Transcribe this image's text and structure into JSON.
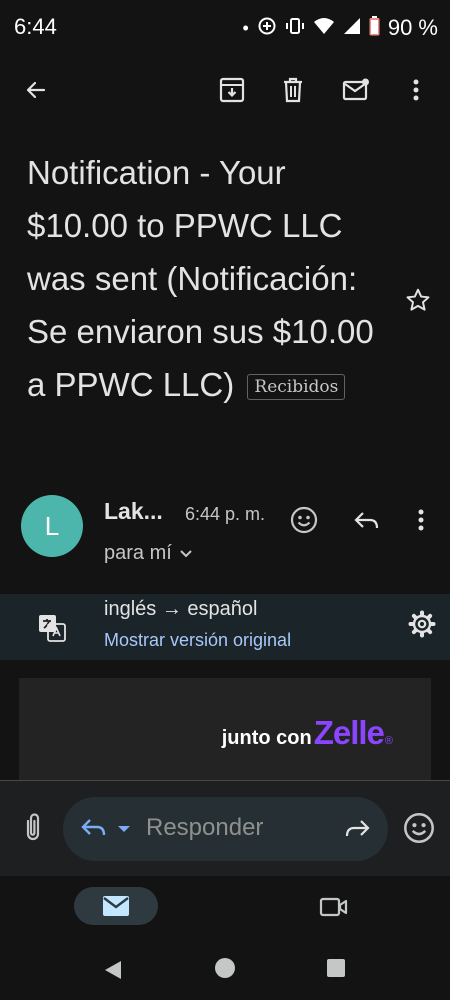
{
  "status_bar": {
    "time": "6:44",
    "battery": "90 %"
  },
  "email": {
    "subject": "Notification - Your $10.00 to PPWC LLC was sent (Notificación: Se enviaron sus $10.00 a PPWC LLC)",
    "label": "Recibidos",
    "sender_initial": "L",
    "sender_name": "Lak...",
    "time": "6:44 p. m.",
    "recipient": "para mí"
  },
  "translation": {
    "languages": "inglés → español",
    "show_original": "Mostrar versión original"
  },
  "body": {
    "brand_prefix": "junto con",
    "brand_logo": "Zelle",
    "brand_mark": "®"
  },
  "reply_bar": {
    "placeholder": "Responder"
  },
  "colors": {
    "background": "#131314",
    "avatar": "#4db6ac",
    "link": "#a8c7fa",
    "brand": "#8b45ff"
  },
  "icons": [
    "back-arrow-icon",
    "archive-icon",
    "trash-icon",
    "mark-unread-icon",
    "more-vert-icon",
    "star-icon",
    "emoji-icon",
    "reply-icon",
    "chevron-down-icon",
    "translate-icon",
    "gear-icon",
    "attachment-icon",
    "forward-icon",
    "mail-icon",
    "video-icon"
  ]
}
